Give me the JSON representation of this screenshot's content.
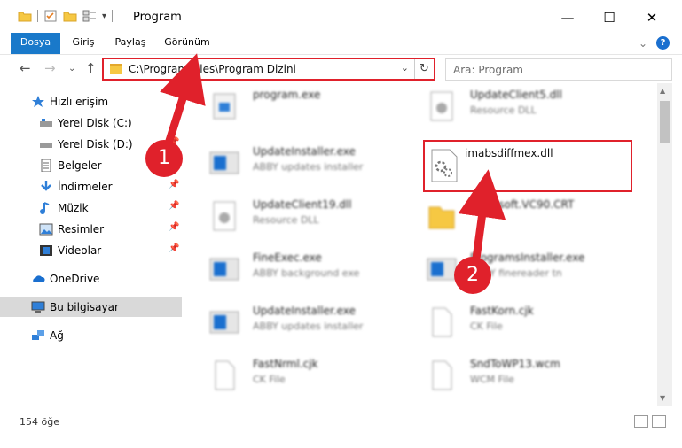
{
  "window": {
    "title": "Program",
    "minimize": "—",
    "maximize": "☐",
    "close": "✕"
  },
  "ribbon": {
    "tabs": [
      "Dosya",
      "Giriş",
      "Paylaş",
      "Görünüm"
    ],
    "expand": "⌄",
    "help": "?"
  },
  "nav": {
    "back": "←",
    "forward": "→",
    "recent": "⌄",
    "up": "↑",
    "address": "C:\\Program Files\\Program Dizini",
    "dropdown": "⌄",
    "refresh": "↻",
    "search_placeholder": "Ara: Program"
  },
  "sidebar": {
    "items": [
      {
        "label": "Hızlı erişim",
        "icon": "star-icon",
        "pinned": false
      },
      {
        "label": "Yerel Disk (C:)",
        "icon": "drive-icon",
        "pinned": false
      },
      {
        "label": "Yerel Disk (D:)",
        "icon": "drive-icon",
        "pinned": true
      },
      {
        "label": "Belgeler",
        "icon": "documents-icon",
        "pinned": true
      },
      {
        "label": "İndirmeler",
        "icon": "download-icon",
        "pinned": true
      },
      {
        "label": "Müzik",
        "icon": "music-icon",
        "pinned": true
      },
      {
        "label": "Resimler",
        "icon": "pictures-icon",
        "pinned": true
      },
      {
        "label": "Videolar",
        "icon": "videos-icon",
        "pinned": true
      },
      {
        "label": "OneDrive",
        "icon": "cloud-icon",
        "pinned": false
      },
      {
        "label": "Bu bilgisayar",
        "icon": "computer-icon",
        "pinned": false
      },
      {
        "label": "Ağ",
        "icon": "network-icon",
        "pinned": false
      }
    ]
  },
  "files": [
    {
      "name": "program.exe",
      "desc": "",
      "icon": "exe-icon"
    },
    {
      "name": "UpdateClient5.dll",
      "desc": "Resource DLL",
      "icon": "dll-icon"
    },
    {
      "name": "UpdateInstaller.exe",
      "desc": "ABBY updates installer",
      "icon": "installer-icon"
    },
    {
      "name": "UpdateClient19.dll",
      "desc": "Resource DLL",
      "icon": "dll-icon"
    },
    {
      "name": "Microsoft.VC90.CRT",
      "desc": "",
      "icon": "folder-icon"
    },
    {
      "name": "FineExec.exe",
      "desc": "ABBY background exe",
      "icon": "installer-icon"
    },
    {
      "name": "ProgramsInstaller.exe",
      "desc": "ABBY finereader tn",
      "icon": "installer-icon"
    },
    {
      "name": "UpdateInstaller.exe",
      "desc": "ABBY updates installer",
      "icon": "installer-icon"
    },
    {
      "name": "FastKorn.cjk",
      "desc": "CK File",
      "icon": "file-icon"
    },
    {
      "name": "FastNrml.cjk",
      "desc": "CK File",
      "icon": "file-icon"
    },
    {
      "name": "SndToWP13.wcm",
      "desc": "WCM File",
      "icon": "file-icon"
    }
  ],
  "target_file": {
    "name": "imabsdiffmex.dll",
    "icon": "gear-dll-icon"
  },
  "status": {
    "count": "154 öğe"
  },
  "annotations": {
    "step1": "1",
    "step2": "2",
    "color": "#e0212b"
  }
}
